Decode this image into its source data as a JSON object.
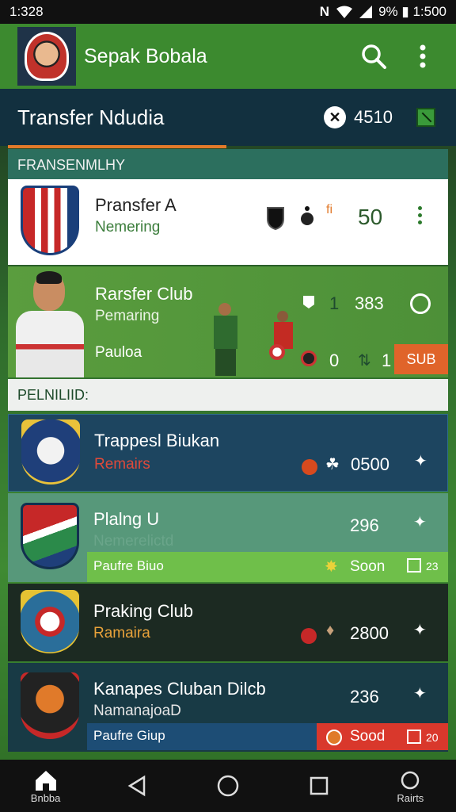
{
  "status": {
    "time": "1:328",
    "right_text": "9% ▮ 1:500"
  },
  "app": {
    "title": "Sepak Bobala"
  },
  "subheader": {
    "title": "Transfer Ndudia",
    "count": "4510"
  },
  "sections": {
    "first": "FRANSENMLHY",
    "second": "PELNILIID:"
  },
  "card1": {
    "title": "Pransfer A",
    "subtitle": "Nemering",
    "value": "50",
    "mini": "fi"
  },
  "card2": {
    "title": "Rarsfer Club",
    "subtitle": "Pemaring",
    "label": "Pauloa",
    "value_top": "1",
    "value_top2": "383",
    "value_bottom": "0",
    "value_bottom2": "1",
    "badge": "SUB"
  },
  "list": [
    {
      "title": "Trappesl Biukan",
      "subtitle": "Remairs",
      "value": "0500"
    },
    {
      "title": "Plalng U",
      "subtitle": "Nemerelictd",
      "value": "296",
      "footer": "Paufre Biuo",
      "footer_right": "Soon",
      "footer_count": "23"
    },
    {
      "title": "Praking Club",
      "subtitle": "Ramaira",
      "value": "2800"
    },
    {
      "title": "Kanapes Cluban Dilcb",
      "subtitle": "NamanajoaD",
      "value": "236",
      "footer": "Paufre Giup",
      "footer_right": "Sood",
      "footer_count": "20"
    }
  ],
  "nav": {
    "home": "Bnbba",
    "points": "Rairts"
  },
  "colors": {
    "app_bar": "#3c8a2f",
    "subheader": "#12303f",
    "accent": "#e27a2a",
    "card_blue": "#1d4560"
  }
}
